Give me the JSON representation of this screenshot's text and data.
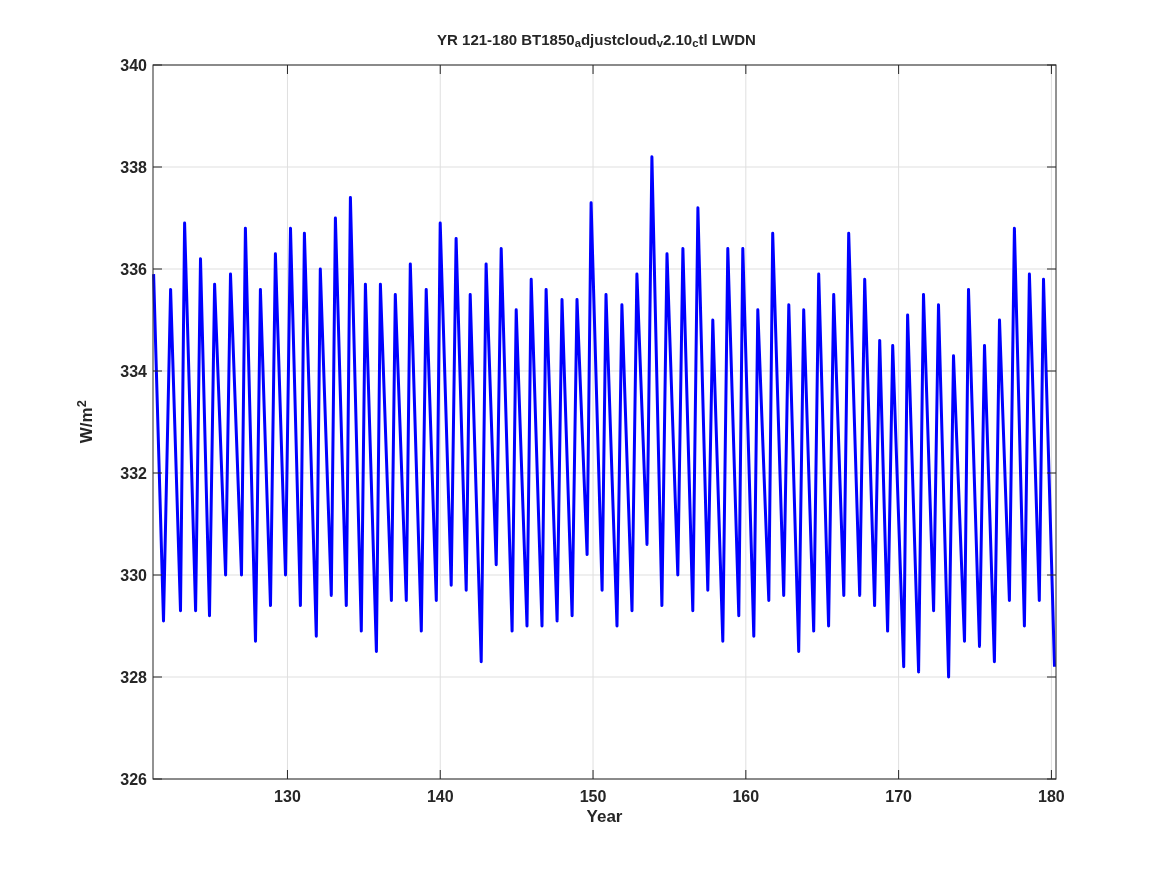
{
  "figure": {
    "chart_data": {
      "type": "line",
      "title": "YR 121-180 BT1850$_{a}$djustcloud$_{v}$2.10$_{c}$tl LWDN",
      "xlabel": "Year",
      "ylabel": "W/m$^{2}$",
      "xlim": [
        121.2,
        180.3
      ],
      "ylim": [
        326,
        340
      ],
      "grid": true,
      "xticks": [
        130,
        140,
        150,
        160,
        170,
        180
      ],
      "yticks": [
        326,
        328,
        330,
        332,
        334,
        336,
        338,
        340
      ],
      "x": [
        121.24,
        121.89,
        122.35,
        123.0,
        123.27,
        123.99,
        124.31,
        124.9,
        125.23,
        125.95,
        126.27,
        126.99,
        127.25,
        127.91,
        128.23,
        128.89,
        129.21,
        129.87,
        130.2,
        130.85,
        131.11,
        131.89,
        132.15,
        132.87,
        133.14,
        133.85,
        134.12,
        134.83,
        135.1,
        135.82,
        136.08,
        136.8,
        137.06,
        137.78,
        138.04,
        138.76,
        139.08,
        139.74,
        140.0,
        140.72,
        141.04,
        141.7,
        141.96,
        142.68,
        143.0,
        143.66,
        143.99,
        144.7,
        144.97,
        145.68,
        145.95,
        146.66,
        146.93,
        147.65,
        147.97,
        148.63,
        148.95,
        149.61,
        149.87,
        150.59,
        150.85,
        151.57,
        151.89,
        152.55,
        152.87,
        153.53,
        153.85,
        154.51,
        154.84,
        155.55,
        155.88,
        156.53,
        156.86,
        157.51,
        157.84,
        158.49,
        158.82,
        159.54,
        159.8,
        160.52,
        160.78,
        161.5,
        161.76,
        162.48,
        162.81,
        163.46,
        163.79,
        164.44,
        164.77,
        165.42,
        165.75,
        166.41,
        166.73,
        167.45,
        167.78,
        168.43,
        168.76,
        169.28,
        169.61,
        170.33,
        170.59,
        171.31,
        171.63,
        172.29,
        172.61,
        173.27,
        173.59,
        174.31,
        174.57,
        175.29,
        175.62,
        176.27,
        176.6,
        177.25,
        177.58,
        178.23,
        178.56,
        179.21,
        179.48,
        180.2
      ],
      "series": [
        {
          "color": "#0000ff",
          "values": [
            335.9,
            329.1,
            335.6,
            329.3,
            336.9,
            329.3,
            336.2,
            329.2,
            335.7,
            330.0,
            335.9,
            330.0,
            336.8,
            328.7,
            335.6,
            329.4,
            336.3,
            330.0,
            336.8,
            329.4,
            336.7,
            328.8,
            336.0,
            329.6,
            337.0,
            329.4,
            337.4,
            328.9,
            335.7,
            328.5,
            335.7,
            329.5,
            335.5,
            329.5,
            336.1,
            328.9,
            335.6,
            329.5,
            336.9,
            329.8,
            336.6,
            329.7,
            335.5,
            328.3,
            336.1,
            330.2,
            336.4,
            328.9,
            335.2,
            329.0,
            335.8,
            329.0,
            335.6,
            329.1,
            335.4,
            329.2,
            335.4,
            330.4,
            337.3,
            329.7,
            335.5,
            329.0,
            335.3,
            329.3,
            335.9,
            330.6,
            338.2,
            329.4,
            336.3,
            330.0,
            336.4,
            329.3,
            337.2,
            329.7,
            335.0,
            328.7,
            336.4,
            329.2,
            336.4,
            328.8,
            335.2,
            329.5,
            336.7,
            329.6,
            335.3,
            328.5,
            335.2,
            328.9,
            335.9,
            329.0,
            335.5,
            329.6,
            336.7,
            329.6,
            335.8,
            329.4,
            334.6,
            328.9,
            334.5,
            328.2,
            335.1,
            328.1,
            335.5,
            329.3,
            335.3,
            328.0,
            334.3,
            328.7,
            335.6,
            328.6,
            334.5,
            328.3,
            335.0,
            329.5,
            336.8,
            329.0,
            335.9,
            329.5,
            335.8,
            328.2
          ]
        }
      ]
    }
  }
}
